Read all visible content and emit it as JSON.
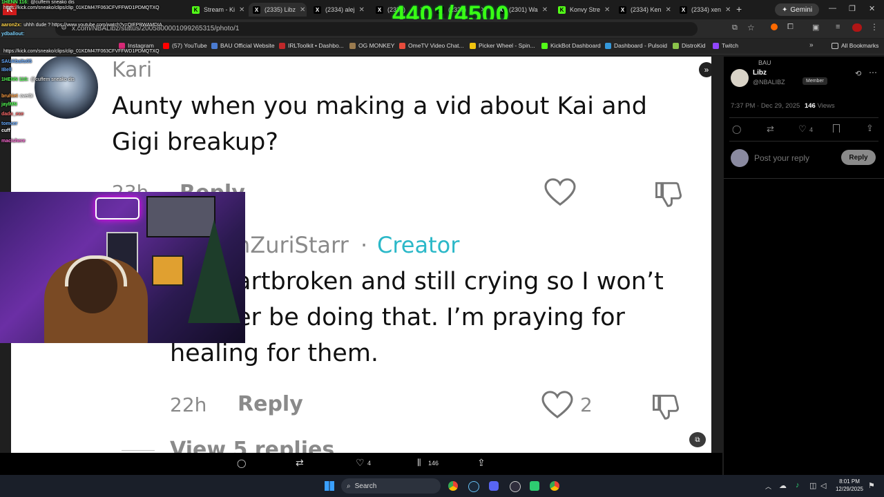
{
  "counter": "4401/4500",
  "tabs": [
    {
      "label": "Stream - Ki",
      "icon": "K",
      "color": "#53fc18"
    },
    {
      "label": "(2335) Libz",
      "icon": "X",
      "color": "#000"
    },
    {
      "label": "(2334) alej",
      "icon": "X",
      "color": "#000"
    },
    {
      "label": "(2330)",
      "icon": "X",
      "color": "#000"
    },
    {
      "label": "(2326)",
      "icon": "X",
      "color": "#000"
    },
    {
      "label": "(2301) Wa",
      "icon": "X",
      "color": "#000"
    },
    {
      "label": "Konvy Stre",
      "icon": "K",
      "color": "#53fc18"
    },
    {
      "label": "(2334) Ken",
      "icon": "X",
      "color": "#000"
    },
    {
      "label": "(2334) xen",
      "icon": "X",
      "color": "#000"
    }
  ],
  "gemini_label": "Gemini",
  "url": "x.com/NBALibz/status/2005800001099265315/photo/1",
  "bookmarks": [
    {
      "label": "Instagram",
      "color": "#d62976"
    },
    {
      "label": "(57) YouTube",
      "color": "#ff0000"
    },
    {
      "label": "BAU Official Website",
      "color": "#4a7bd1"
    },
    {
      "label": "IRLToolkit • Dashbo...",
      "color": "#c0282a"
    },
    {
      "label": "OG MONKEY",
      "color": "#9a7b4f"
    },
    {
      "label": "OmeTV Video Chat...",
      "color": "#e74c3c"
    },
    {
      "label": "Picker Wheel - Spin...",
      "color": "#f1c40f"
    },
    {
      "label": "KickBot Dashboard",
      "color": "#53fc18"
    },
    {
      "label": "Dashboard - Pulsoid",
      "color": "#3498db"
    },
    {
      "label": "DistroKid",
      "color": "#8bc34a"
    },
    {
      "label": "Twitch",
      "color": "#9146ff"
    }
  ],
  "all_bookmarks": "All Bookmarks",
  "comment1": {
    "author": "Kari",
    "text_line1": "Aunty when you making a vid about Kai and",
    "text_line2": "Gigi breakup?",
    "time": "23h",
    "reply": "Reply"
  },
  "comment2": {
    "author": "hZuriStarr",
    "badge": "Creator",
    "separator": "·",
    "line1": "artbroken and still crying so I won’t",
    "line2": "er be doing that. I’m praying for",
    "line3": "healing for them.",
    "time": "22h",
    "reply": "Reply",
    "likes": "2"
  },
  "view_replies": "View 5 replies",
  "side": {
    "group": "BAU",
    "name": "Libz",
    "handle": "@NBALIBZ",
    "member_badge": "Member",
    "timestamp": "7:37 PM · Dec 29, 2025",
    "views_count": "146",
    "views_label": "Views",
    "likes": "4",
    "reply_placeholder": "Post your reply",
    "reply_button": "Reply"
  },
  "bottom": {
    "likes": "4",
    "views": "146"
  },
  "taskbar": {
    "search": "Search",
    "time": "8:01 PM",
    "date": "12/29/2025"
  },
  "chat": [
    {
      "user": "1HENN 116:",
      "msg": "@cuffem sneako dis",
      "color": "#55ff55"
    },
    {
      "user": "",
      "msg": "https://kick.com/sneako/clips/clip_01KDM47F063CFVFFWD1PDMQTXQ",
      "color": "#ffffff"
    },
    {
      "user": "aaron2x:",
      "msg": "uhhh dude ? https://www.youtube.com/watch?v=QIEPRWAMDIA",
      "color": "#ffd54a"
    },
    {
      "user": "ydballout:",
      "msg": "",
      "color": "#7fd4ff"
    },
    {
      "user": "",
      "msg": "https://kick.com/sneako/clips/clip_01KDM47F063CFVFFWD1PDMQTXQ",
      "color": "#ffffff"
    },
    {
      "user": "SAUAbaits05",
      "msg": "",
      "color": "#66aaff"
    },
    {
      "user": "IBell",
      "msg": "",
      "color": "#66aaff"
    },
    {
      "user": "1HENN 116:",
      "msg": "@cuffem sneako dis",
      "color": "#55ff55"
    },
    {
      "user": "bruhiet",
      "msg": "overbi",
      "color": "#ff9f43"
    },
    {
      "user": "jaylMN",
      "msg": "",
      "color": "#55ff55"
    },
    {
      "user": "dado_exe",
      "msg": "",
      "color": "#ff6b6b"
    },
    {
      "user": "tomcer",
      "msg": "",
      "color": "#66aaff"
    },
    {
      "user": "cuff",
      "msg": "",
      "color": "#ffffff"
    },
    {
      "user": "macishere",
      "msg": "",
      "color": "#ff6bd6"
    }
  ]
}
